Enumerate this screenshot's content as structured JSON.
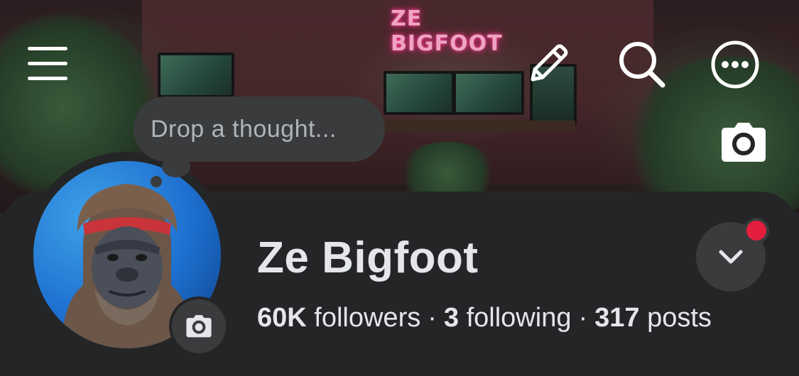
{
  "cover": {
    "neon_sign": "ZE BIGFOOT"
  },
  "header": {
    "icons": [
      "menu-icon",
      "pencil-icon",
      "search-icon",
      "more-icon"
    ],
    "cover_camera_icon": "camera-icon"
  },
  "profile": {
    "thought_placeholder": "Drop a thought...",
    "name": "Ze Bigfoot",
    "stats": {
      "followers_count": "60K",
      "followers_label": "followers",
      "following_count": "3",
      "following_label": "following",
      "posts_count": "317",
      "posts_label": "posts",
      "separator": "·"
    },
    "avatar_camera_icon": "camera-icon",
    "dropdown_icon": "chevron-down-icon"
  },
  "colors": {
    "background": "#242526",
    "surface": "#3a3b3c",
    "text_primary": "#e4e6eb",
    "text_secondary": "#b0b3b8",
    "notification_dot": "#e41e3f",
    "avatar_background": "#1d6fcf"
  }
}
